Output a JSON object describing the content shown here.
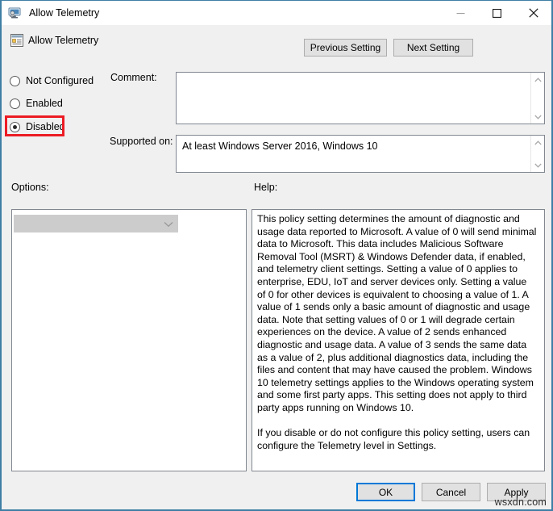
{
  "window": {
    "title": "Allow Telemetry",
    "title_icon": "computer-policy-icon",
    "minimize_icon": "minimize-icon",
    "maximize_icon": "maximize-icon",
    "close_icon": "close-icon"
  },
  "header": {
    "policy_icon": "policy-setting-icon",
    "policy_name": "Allow Telemetry",
    "previous_setting_label": "Previous Setting",
    "next_setting_label": "Next Setting"
  },
  "state_options": [
    {
      "label": "Not Configured",
      "selected": false
    },
    {
      "label": "Enabled",
      "selected": false
    },
    {
      "label": "Disabled",
      "selected": true
    }
  ],
  "highlight": {
    "target": "Disabled",
    "color": "#ec1c24"
  },
  "fields": {
    "comment_label": "Comment:",
    "comment_value": "",
    "supported_label": "Supported on:",
    "supported_value": "At least Windows Server 2016, Windows 10",
    "scroll_up_icon": "chevron-up-icon",
    "scroll_down_icon": "chevron-down-icon"
  },
  "options": {
    "label": "Options:",
    "dropdown_value": "",
    "dropdown_enabled": false,
    "dropdown_icon": "chevron-down-icon"
  },
  "help": {
    "label": "Help:",
    "text": "This policy setting determines the amount of diagnostic and usage data reported to Microsoft. A value of 0 will send minimal data to Microsoft. This data includes Malicious Software Removal Tool (MSRT) & Windows Defender data, if enabled, and telemetry client settings. Setting a value of 0 applies to enterprise, EDU, IoT and server devices only. Setting a value of 0 for other devices is equivalent to choosing a value of 1. A value of 1 sends only a basic amount of diagnostic and usage data. Note that setting values of 0 or 1 will degrade certain experiences on the device. A value of 2 sends enhanced diagnostic and usage data. A value of 3 sends the same data as a value of 2, plus additional diagnostics data, including the files and content that may have caused the problem. Windows 10 telemetry settings applies to the Windows operating system and some first party apps. This setting does not apply to third party apps running on Windows 10.\n\nIf you disable or do not configure this policy setting, users can configure the Telemetry level in Settings."
  },
  "footer": {
    "ok_label": "OK",
    "cancel_label": "Cancel",
    "apply_label": "Apply",
    "accent_color": "#0078d7"
  },
  "watermark": "wsxdn.com"
}
